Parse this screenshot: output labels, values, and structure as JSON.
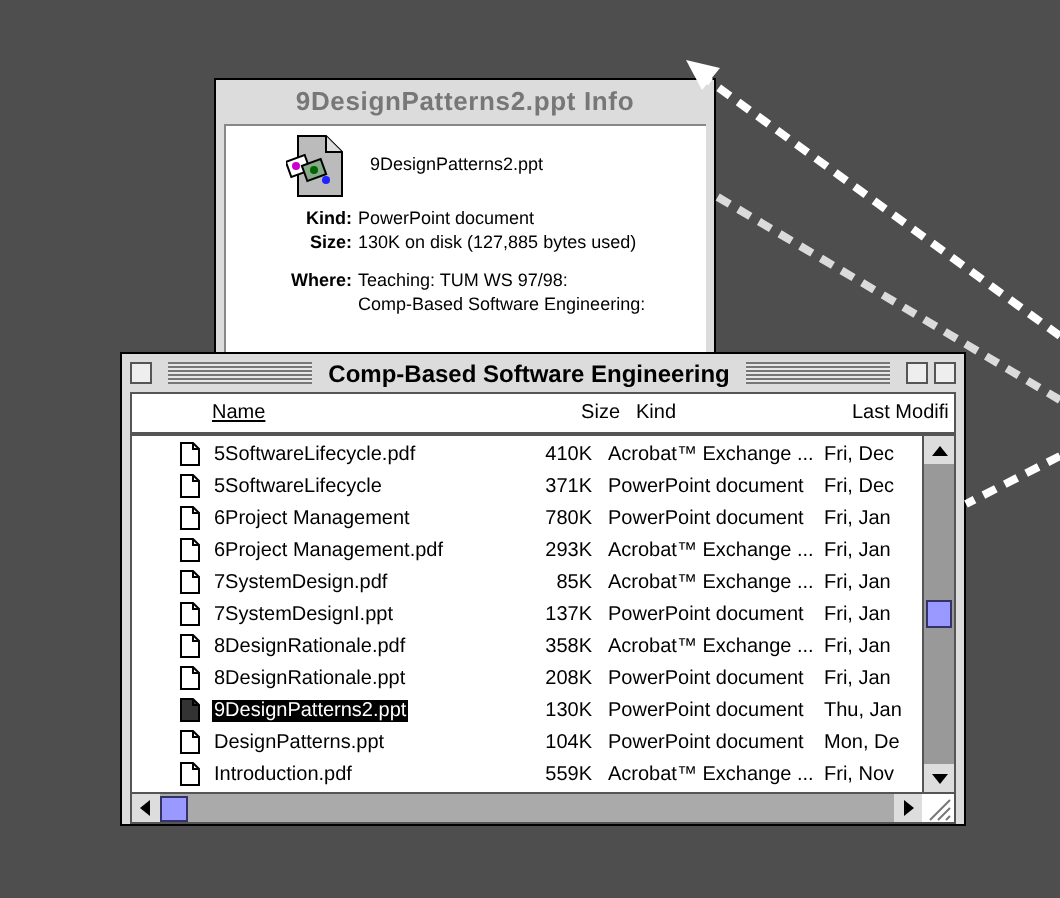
{
  "info_window": {
    "title": "9DesignPatterns2.ppt Info",
    "file_name": "9DesignPatterns2.ppt",
    "fields": [
      {
        "label": "Kind:",
        "lines": [
          "PowerPoint document"
        ]
      },
      {
        "label": "Size:",
        "lines": [
          "130K on disk (127,885 bytes used)"
        ]
      },
      {
        "label": "Where:",
        "lines": [
          "Teaching: TUM WS 97/98:",
          "Comp-Based Software Engineering:"
        ]
      }
    ]
  },
  "list_window": {
    "title": "Comp-Based Software Engineering",
    "columns": [
      "Name",
      "Size",
      "Kind",
      "Last Modifi"
    ],
    "rows": [
      {
        "name": "5SoftwareLifecycle.pdf",
        "size": "410K",
        "kind": "Acrobat™ Exchange ...",
        "modified": "Fri, Dec",
        "selected": false
      },
      {
        "name": "5SoftwareLifecycle",
        "size": "371K",
        "kind": "PowerPoint document",
        "modified": "Fri, Dec",
        "selected": false
      },
      {
        "name": "6Project Management",
        "size": "780K",
        "kind": "PowerPoint document",
        "modified": "Fri, Jan",
        "selected": false
      },
      {
        "name": "6Project Management.pdf",
        "size": "293K",
        "kind": "Acrobat™ Exchange ...",
        "modified": "Fri, Jan",
        "selected": false
      },
      {
        "name": "7SystemDesign.pdf",
        "size": "85K",
        "kind": "Acrobat™ Exchange ...",
        "modified": "Fri, Jan",
        "selected": false
      },
      {
        "name": "7SystemDesignI.ppt",
        "size": "137K",
        "kind": "PowerPoint document",
        "modified": "Fri, Jan",
        "selected": false
      },
      {
        "name": "8DesignRationale.pdf",
        "size": "358K",
        "kind": "Acrobat™ Exchange ...",
        "modified": "Fri, Jan",
        "selected": false
      },
      {
        "name": "8DesignRationale.ppt",
        "size": "208K",
        "kind": "PowerPoint document",
        "modified": "Fri, Jan",
        "selected": false
      },
      {
        "name": "9DesignPatterns2.ppt",
        "size": "130K",
        "kind": "PowerPoint document",
        "modified": "Thu, Jan",
        "selected": true
      },
      {
        "name": "DesignPatterns.ppt",
        "size": "104K",
        "kind": "PowerPoint document",
        "modified": "Mon, De",
        "selected": false
      },
      {
        "name": "Introduction.pdf",
        "size": "559K",
        "kind": "Acrobat™ Exchange ...",
        "modified": "Fri, Nov",
        "selected": false
      }
    ]
  }
}
